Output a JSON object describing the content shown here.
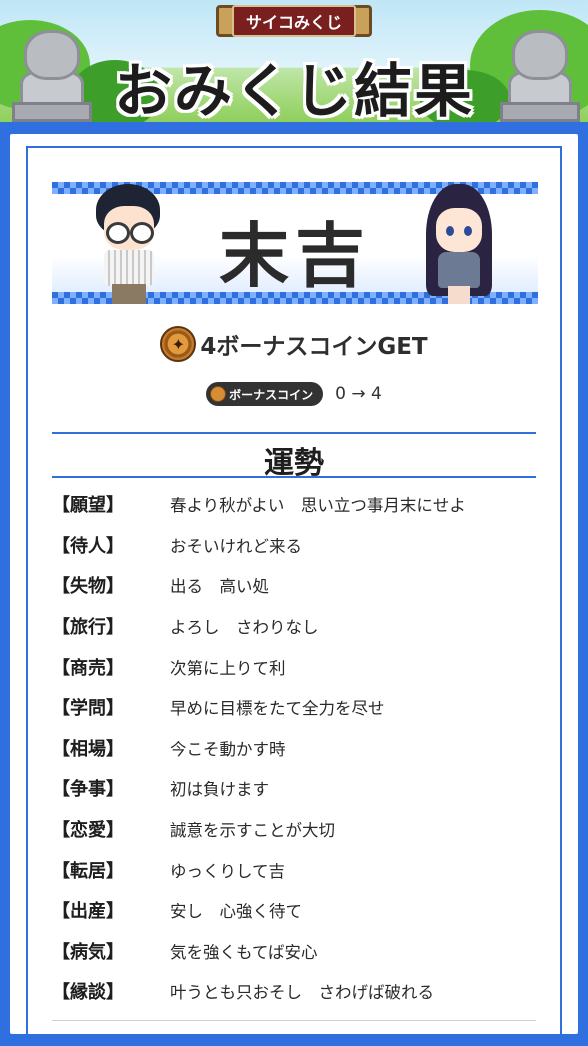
{
  "header": {
    "sign_label": "サイコみくじ",
    "title": "おみくじ結果"
  },
  "result": {
    "fortune": "末吉",
    "coin_icon": "bonus-coin-icon",
    "coin_gain": "4ボーナスコインGET",
    "badge_label": "ボーナスコイン",
    "balance": "0 → 4"
  },
  "section": {
    "title": "運勢"
  },
  "fortunes": [
    {
      "label": "【願望】",
      "value": "春より秋がよい　思い立つ事月末にせよ"
    },
    {
      "label": "【待人】",
      "value": "おそいけれど来る"
    },
    {
      "label": "【失物】",
      "value": "出る　高い処"
    },
    {
      "label": "【旅行】",
      "value": "よろし　さわりなし"
    },
    {
      "label": "【商売】",
      "value": "次第に上りて利"
    },
    {
      "label": "【学問】",
      "value": "早めに目標をたて全力を尽せ"
    },
    {
      "label": "【相場】",
      "value": "今こそ動かす時"
    },
    {
      "label": "【争事】",
      "value": "初は負けます"
    },
    {
      "label": "【恋愛】",
      "value": "誠意を示すことが大切"
    },
    {
      "label": "【転居】",
      "value": "ゆっくりして吉"
    },
    {
      "label": "【出産】",
      "value": "安し　心強く待て"
    },
    {
      "label": "【病気】",
      "value": "気を強くもてば安心"
    },
    {
      "label": "【縁談】",
      "value": "叶うとも只おそし　さわげば破れる"
    }
  ],
  "colors": {
    "accent": "#2f6fe0",
    "badge": "#333333",
    "coin": "#d88c34"
  }
}
